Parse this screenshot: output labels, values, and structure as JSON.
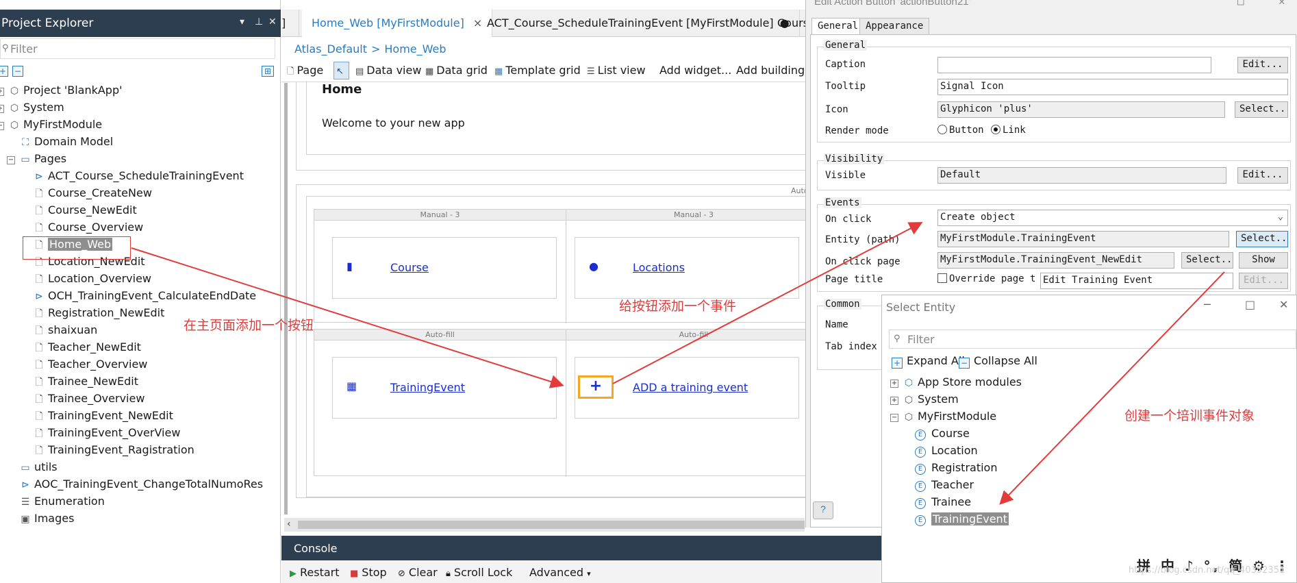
{
  "explorer": {
    "title": "Project Explorer",
    "filter_placeholder": "Filter",
    "tree": [
      {
        "label": "Project 'BlankApp'",
        "icon": "project-icon"
      },
      {
        "label": "System",
        "icon": "module-icon"
      },
      {
        "label": "MyFirstModule",
        "icon": "module-icon"
      },
      {
        "label": "Domain Model",
        "icon": "domain-model-icon"
      },
      {
        "label": "Pages",
        "icon": "folder-icon"
      },
      {
        "label": "ACT_Course_ScheduleTrainingEvent",
        "icon": "microflow-icon"
      },
      {
        "label": "Course_CreateNew",
        "icon": "page-icon"
      },
      {
        "label": "Course_NewEdit",
        "icon": "page-icon"
      },
      {
        "label": "Course_Overview",
        "icon": "page-icon"
      },
      {
        "label": "Home_Web",
        "icon": "page-icon"
      },
      {
        "label": "Location_NewEdit",
        "icon": "page-icon"
      },
      {
        "label": "Location_Overview",
        "icon": "page-icon"
      },
      {
        "label": "OCH_TrainingEvent_CalculateEndDate",
        "icon": "microflow-icon"
      },
      {
        "label": "Registration_NewEdit",
        "icon": "page-icon"
      },
      {
        "label": "shaixuan",
        "icon": "page-icon"
      },
      {
        "label": "Teacher_NewEdit",
        "icon": "page-icon"
      },
      {
        "label": "Teacher_Overview",
        "icon": "page-icon"
      },
      {
        "label": "Trainee_NewEdit",
        "icon": "page-icon"
      },
      {
        "label": "Trainee_Overview",
        "icon": "page-icon"
      },
      {
        "label": "TrainingEvent_NewEdit",
        "icon": "page-icon"
      },
      {
        "label": "TrainingEvent_OverView",
        "icon": "page-icon"
      },
      {
        "label": "TrainingEvent_Ragistration",
        "icon": "page-icon"
      },
      {
        "label": "utils",
        "icon": "folder-icon"
      },
      {
        "label": "AOC_TrainingEvent_ChangeTotalNumoRes",
        "icon": "microflow-icon"
      },
      {
        "label": "Enumeration",
        "icon": "enumeration-icon"
      },
      {
        "label": "Images",
        "icon": "images-icon"
      }
    ]
  },
  "editor": {
    "tabs": [
      {
        "label": "]"
      },
      {
        "label": "Home_Web [MyFirstModule]",
        "close": "×"
      },
      {
        "label": "ACT_Course_ScheduleTrainingEvent [MyFirstModule]",
        "close": "●"
      },
      {
        "label": "Cours"
      }
    ],
    "breadcrumb": {
      "first": "Atlas_Default",
      "separator": ">",
      "second": "Home_Web"
    },
    "toolbar": {
      "page": "Page",
      "data_view": "Data view",
      "data_grid": "Data grid",
      "template_grid": "Template grid",
      "list_view": "List view",
      "add_widget": "Add widget...",
      "add_building": "Add building b"
    },
    "canvas": {
      "heading": "Home",
      "welcome": "Welcome to your new app",
      "auto_label": "Auto",
      "row1_head_1": "Manual - 3",
      "row1_head_2": "Manual - 3",
      "row2_head_1": "Auto-fill",
      "row2_head_2": "Auto-fill",
      "cards": {
        "course": "Course",
        "locations": "Locations",
        "training_event": "TrainingEvent",
        "add_training_event": "ADD a training event",
        "plus": "+"
      }
    },
    "console": {
      "title": "Console",
      "restart": "Restart",
      "stop": "Stop",
      "clear": "Clear",
      "scroll_lock": "Scroll Lock",
      "advanced": "Advanced"
    }
  },
  "dialog": {
    "title": "Edit Action Button 'actionButton21'",
    "tabs": {
      "general": "General",
      "appearance": "Appearance"
    },
    "general": {
      "group_label": "General",
      "caption_label": "Caption",
      "caption_value": "",
      "caption_edit": "Edit...",
      "tooltip_label": "Tooltip",
      "tooltip_value": "Signal Icon",
      "icon_label": "Icon",
      "icon_value": "Glyphicon 'plus'",
      "icon_select": "Select..",
      "render_label": "Render mode",
      "render_button": "Button",
      "render_link": "Link",
      "render_selected": "Link"
    },
    "visibility": {
      "group_label": "Visibility",
      "visible_label": "Visible",
      "visible_value": "Default",
      "visible_edit": "Edit..."
    },
    "events": {
      "group_label": "Events",
      "on_click_label": "On click",
      "on_click_value": "Create object",
      "entity_label": "Entity (path)",
      "entity_value": "MyFirstModule.TrainingEvent",
      "entity_select": "Select..",
      "on_click_page_label": "On click page",
      "on_click_page_value": "MyFirstModule.TrainingEvent_NewEdit",
      "on_click_page_select": "Select..",
      "on_click_page_show": "Show",
      "page_title_label": "Page title",
      "override_label": "Override page t",
      "page_title_value": "Edit Training Event",
      "page_title_edit": "Edit..."
    },
    "common": {
      "group_label": "Common",
      "name_label": "Name",
      "tab_index_label": "Tab index"
    },
    "help": "?"
  },
  "select_entity": {
    "title": "Select Entity",
    "filter_placeholder": "Filter",
    "expand_all": "Expand All",
    "collapse_all": "Collapse All",
    "tree": [
      {
        "label": "App Store modules",
        "icon": "app-store-icon"
      },
      {
        "label": "System",
        "icon": "module-icon"
      },
      {
        "label": "MyFirstModule",
        "icon": "module-icon"
      },
      {
        "label": "Course",
        "icon": "entity-icon"
      },
      {
        "label": "Location",
        "icon": "entity-icon"
      },
      {
        "label": "Registration",
        "icon": "entity-icon"
      },
      {
        "label": "Teacher",
        "icon": "entity-icon"
      },
      {
        "label": "Trainee",
        "icon": "entity-icon"
      },
      {
        "label": "TrainingEvent",
        "icon": "entity-icon"
      }
    ]
  },
  "annotations": {
    "add_button": "在主页面添加一个按钮",
    "add_event": "给按钮添加一个事件",
    "create_object": "创建一个培训事件对象"
  },
  "ime_bar": "拼 中 ♪ °, 简 ⚙ ⋮",
  "watermark": "https://blog.csdn.net/qq_40352351",
  "colors": {
    "accent": "#2b7bbf",
    "annotation": "#e23b3b",
    "header": "#2d3e50",
    "highlight": "#f5a623"
  }
}
